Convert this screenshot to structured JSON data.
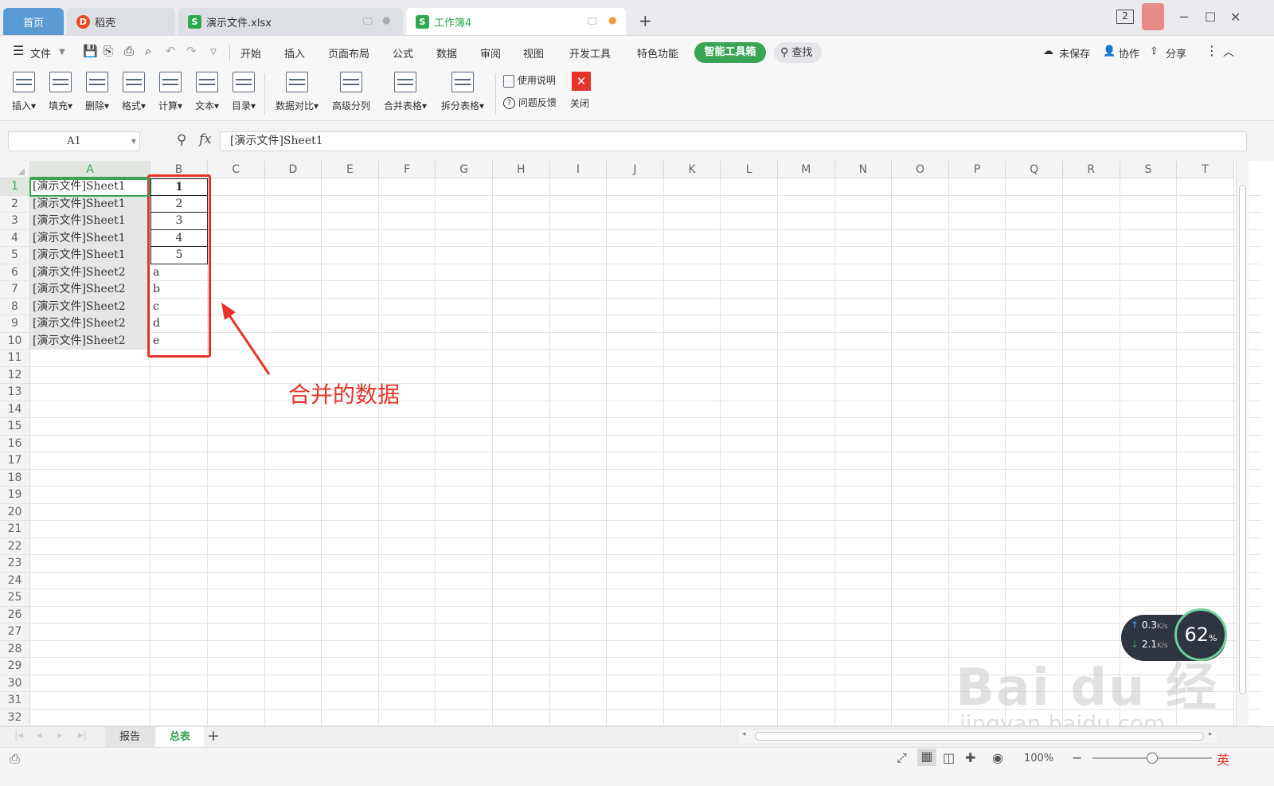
{
  "tabs": [
    {
      "label": "首页"
    },
    {
      "label": "稻壳"
    },
    {
      "label": "演示文件.xlsx"
    },
    {
      "label": "工作簿4"
    }
  ],
  "titlebar": {
    "window_count": "2",
    "new_tab": "+"
  },
  "menubar": {
    "file": "文件",
    "items": [
      "开始",
      "插入",
      "页面布局",
      "公式",
      "数据",
      "审阅",
      "视图",
      "开发工具",
      "特色功能"
    ],
    "smart_toolbox": "智能工具箱",
    "search": "查找",
    "unsaved": "未保存",
    "collab": "协作",
    "share": "分享"
  },
  "ribbon": {
    "buttons": [
      "插入",
      "填充",
      "删除",
      "格式",
      "计算",
      "文本",
      "目录",
      "数据对比",
      "高级分列",
      "合并表格",
      "拆分表格"
    ],
    "help": "使用说明",
    "feedback": "问题反馈",
    "close": "关闭"
  },
  "formula": {
    "cell_ref": "A1",
    "fx": "fx",
    "content": "[演示文件]Sheet1"
  },
  "columns": [
    "A",
    "B",
    "C",
    "D",
    "E",
    "F",
    "G",
    "H",
    "I",
    "J",
    "K",
    "L",
    "M",
    "N",
    "O",
    "P",
    "Q",
    "R",
    "S",
    "T"
  ],
  "rows": [
    "1",
    "2",
    "3",
    "4",
    "5",
    "6",
    "7",
    "8",
    "9",
    "10",
    "11",
    "12",
    "13",
    "14",
    "15",
    "16",
    "17",
    "18",
    "19",
    "20",
    "21",
    "22",
    "23",
    "24",
    "25",
    "26",
    "27",
    "28",
    "29",
    "30",
    "31",
    "32"
  ],
  "cells": {
    "A": [
      "[演示文件]Sheet1",
      "[演示文件]Sheet1",
      "[演示文件]Sheet1",
      "[演示文件]Sheet1",
      "[演示文件]Sheet1",
      "[演示文件]Sheet2",
      "[演示文件]Sheet2",
      "[演示文件]Sheet2",
      "[演示文件]Sheet2",
      "[演示文件]Sheet2"
    ],
    "B": [
      "1",
      "2",
      "3",
      "4",
      "5",
      "a",
      "b",
      "c",
      "d",
      "e"
    ]
  },
  "annotation": {
    "text": "合并的数据"
  },
  "sheets": {
    "items": [
      "报告",
      "总表"
    ],
    "active": "总表",
    "add": "+"
  },
  "network": {
    "up": "0.3",
    "down": "2.1",
    "unit": "K/s",
    "percent": "62",
    "percent_unit": "%"
  },
  "statusbar": {
    "zoom": "100%",
    "ime": "英"
  },
  "watermark": {
    "line1": "Bai du 经验",
    "line2": "jingyan.baidu.com"
  },
  "colors": {
    "accent_green": "#3aa655",
    "tab_blue": "#5b9bd5",
    "annotation_red": "#e8332a"
  }
}
